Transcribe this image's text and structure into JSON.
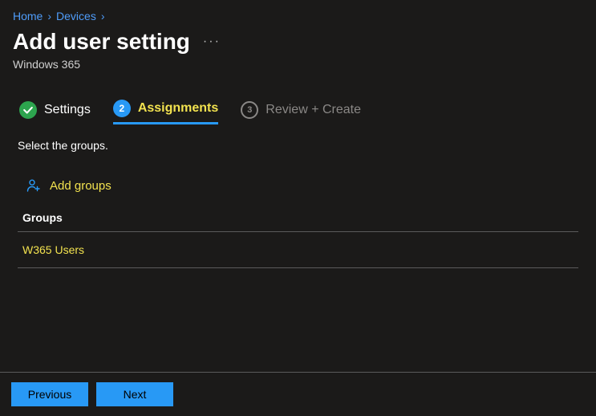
{
  "breadcrumb": {
    "items": [
      "Home",
      "Devices"
    ]
  },
  "header": {
    "title": "Add user setting",
    "subtitle": "Windows 365",
    "moreGlyph": "···"
  },
  "tabs": {
    "settings": {
      "label": "Settings"
    },
    "assignments": {
      "num": "2",
      "label": "Assignments"
    },
    "review": {
      "num": "3",
      "label": "Review + Create"
    }
  },
  "content": {
    "instruction": "Select the groups.",
    "addGroupsLabel": "Add groups",
    "groupsHeader": "Groups",
    "groupRows": [
      "W365 Users"
    ]
  },
  "footer": {
    "previous": "Previous",
    "next": "Next"
  }
}
